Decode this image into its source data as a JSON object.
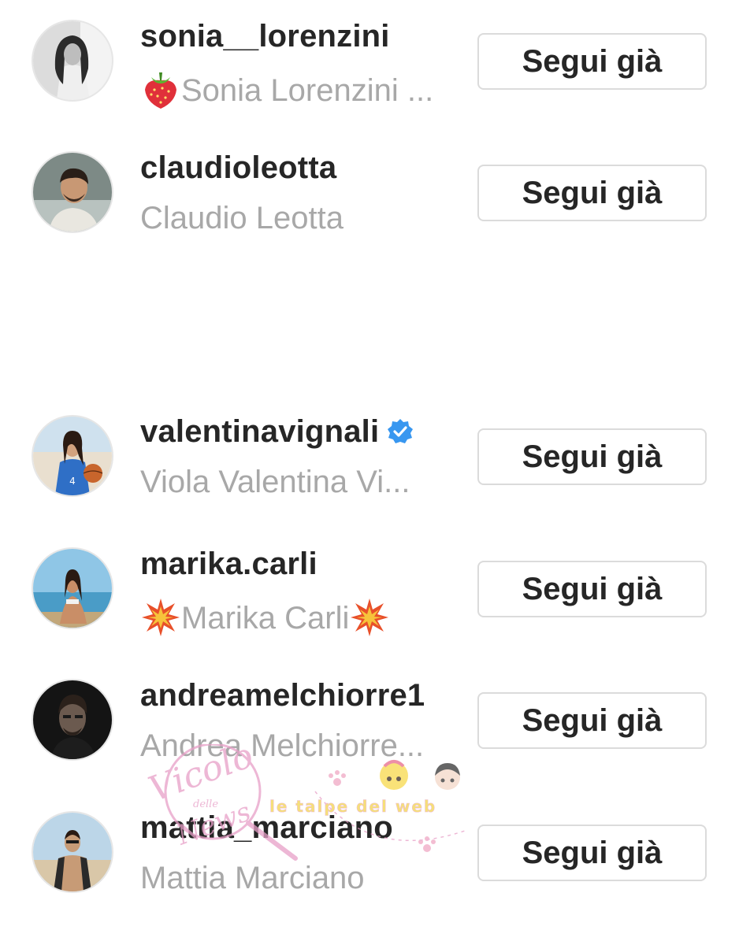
{
  "following_list": {
    "items": [
      {
        "username": "sonia__lorenzini",
        "full_name": "Sonia Lorenzini ...",
        "name_prefix_emoji": "strawberry-emoji",
        "button_label": "Segui già",
        "verified": false
      },
      {
        "username": "claudioleotta",
        "full_name": "Claudio Leotta",
        "button_label": "Segui già",
        "verified": false
      },
      {
        "username": "valentinavignali",
        "full_name": "Viola Valentina Vi...",
        "button_label": "Segui già",
        "verified": true
      },
      {
        "username": "marika.carli",
        "full_name": "Marika Carli",
        "name_prefix_emoji": "collision-emoji",
        "name_suffix_emoji": "collision-emoji",
        "button_label": "Segui già",
        "verified": false
      },
      {
        "username": "andreamelchiorre1",
        "full_name": "Andrea Melchiorre...",
        "button_label": "Segui già",
        "verified": false
      },
      {
        "username": "mattia_marciano",
        "full_name": "Mattia Marciano",
        "button_label": "Segui già",
        "verified": false
      }
    ]
  },
  "watermark": {
    "line1": "Vicolo",
    "line2": "delle",
    "line3": "News",
    "tagline": "le talpe del web"
  },
  "colors": {
    "username": "#262626",
    "full_name": "#a8a8a8",
    "button_border": "#dbdbdb",
    "verified_badge": "#3897f0",
    "watermark_pink": "#e8a0c8",
    "watermark_yellow": "#f3d64a"
  }
}
